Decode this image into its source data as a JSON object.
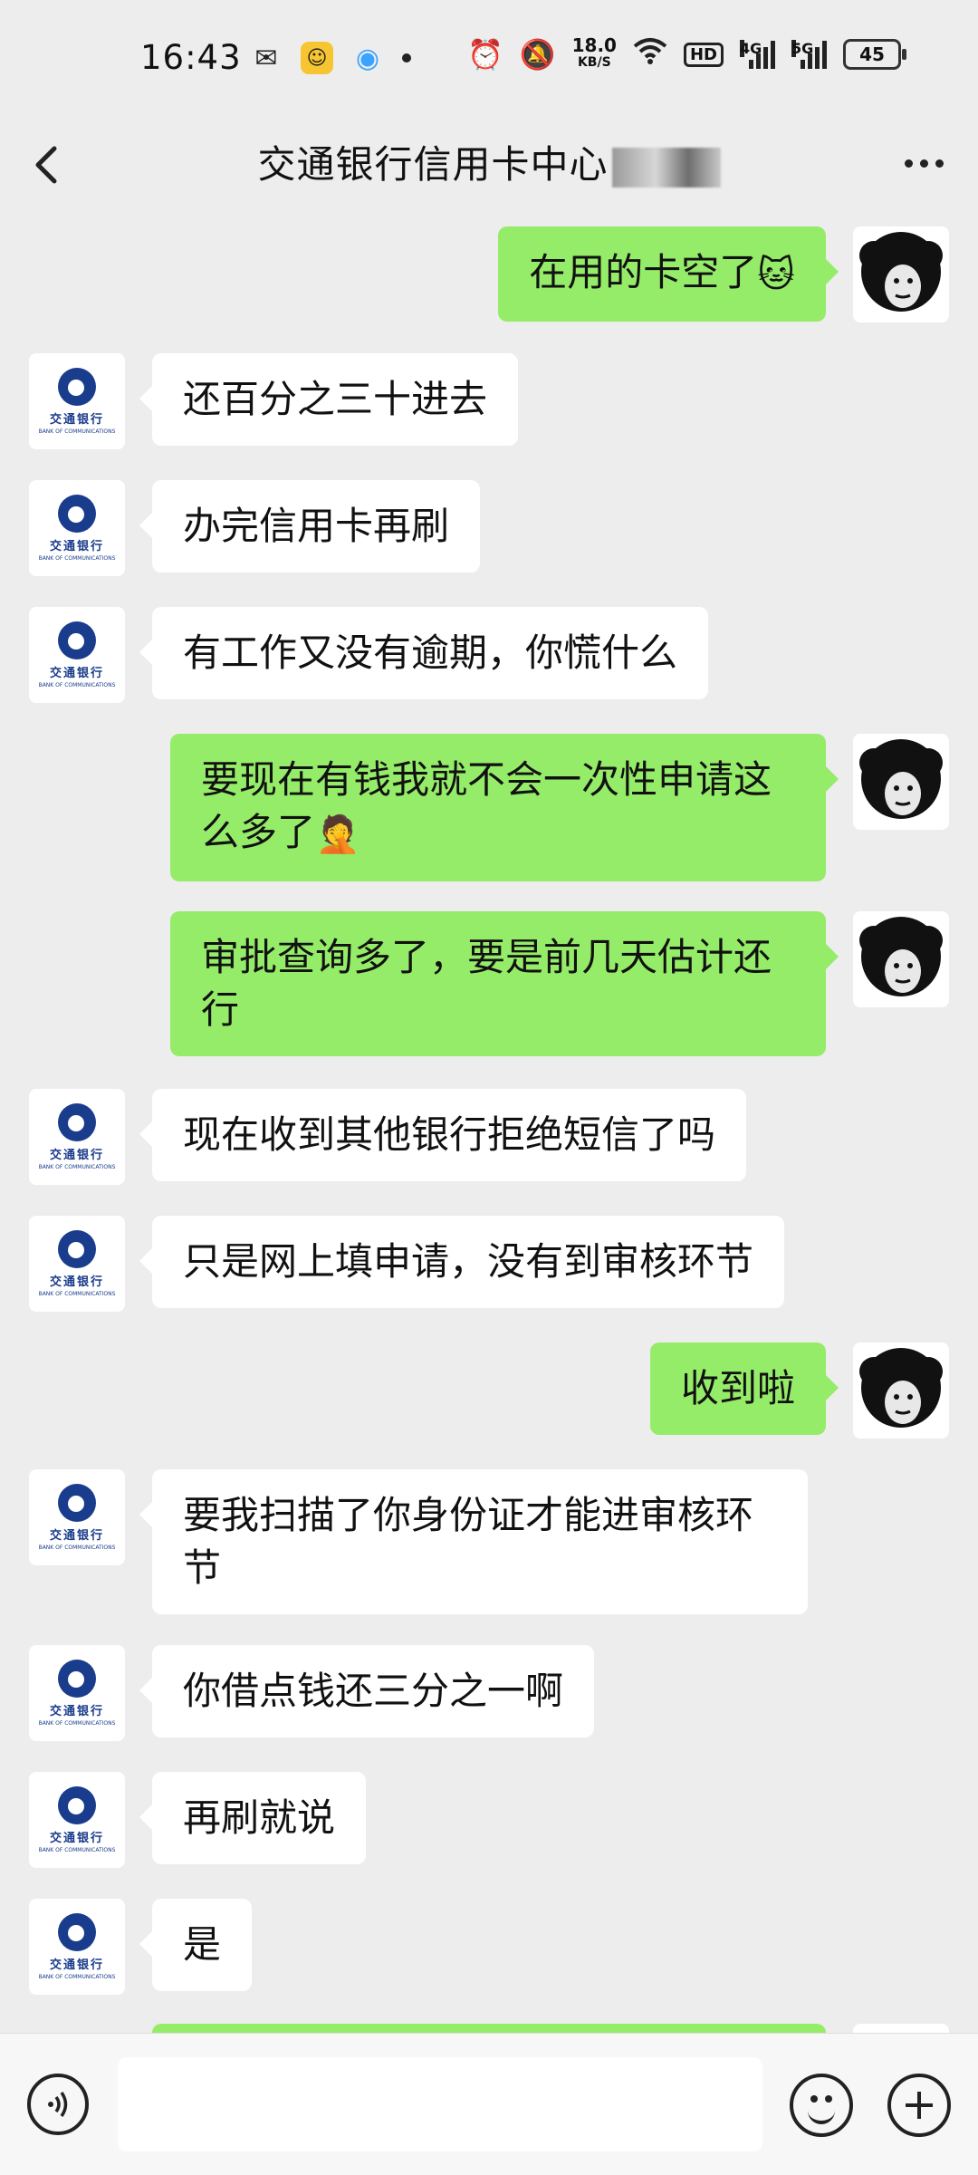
{
  "status_bar": {
    "time": "16:43",
    "net_speed_value": "18.0",
    "net_speed_unit": "KB/S",
    "signal_4g": "4G",
    "signal_5g": "5G",
    "hd": "HD",
    "battery": "45"
  },
  "header": {
    "title": "交通银行信用卡中心"
  },
  "bank_logo": {
    "name_cn": "交通银行",
    "name_en": "BANK OF COMMUNICATIONS"
  },
  "messages": [
    {
      "from": "me",
      "text": "在用的卡空了",
      "emoji": "🐱"
    },
    {
      "from": "bank",
      "text": "还百分之三十进去"
    },
    {
      "from": "bank",
      "text": "办完信用卡再刷"
    },
    {
      "from": "bank",
      "text": "有工作又没有逾期，你慌什么"
    },
    {
      "from": "me",
      "text": "要现在有钱我就不会一次性申请这么多了",
      "emoji": "🤦"
    },
    {
      "from": "me",
      "text": "审批查询多了，要是前几天估计还行"
    },
    {
      "from": "bank",
      "text": "现在收到其他银行拒绝短信了吗"
    },
    {
      "from": "bank",
      "text": "只是网上填申请，没有到审核环节"
    },
    {
      "from": "me",
      "text": "收到啦"
    },
    {
      "from": "bank",
      "text": "要我扫描了你身份证才能进审核环节"
    },
    {
      "from": "bank",
      "text": "你借点钱还三分之一啊"
    },
    {
      "from": "bank",
      "text": "再刷就说"
    },
    {
      "from": "bank",
      "text": "是"
    }
  ],
  "input_bar": {
    "placeholder": ""
  }
}
